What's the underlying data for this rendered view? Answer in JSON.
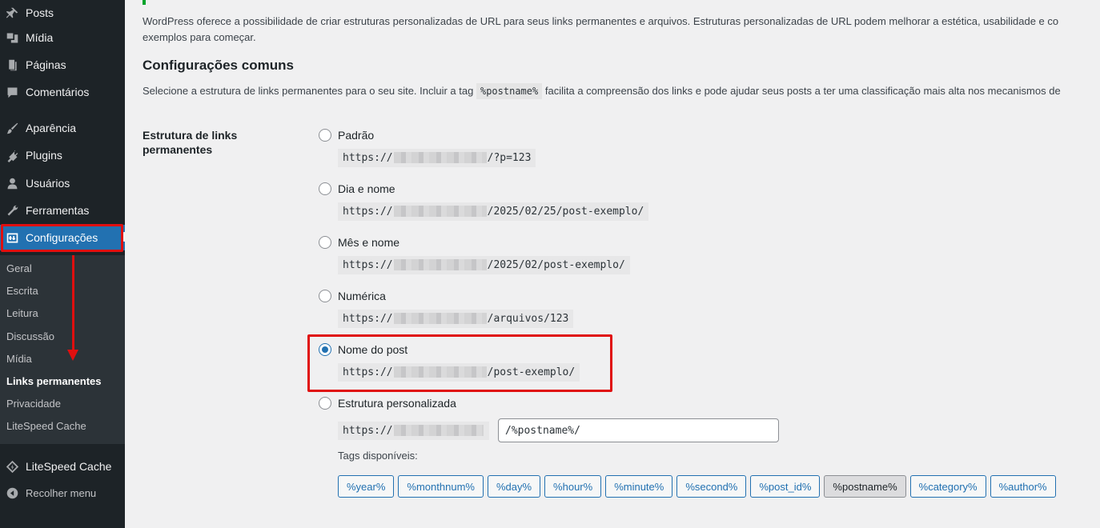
{
  "sidebar": {
    "items": [
      {
        "label": "Posts",
        "icon": "pin-icon"
      },
      {
        "label": "Mídia",
        "icon": "media-icon"
      },
      {
        "label": "Páginas",
        "icon": "pages-icon"
      },
      {
        "label": "Comentários",
        "icon": "comments-icon"
      },
      {
        "label": "Aparência",
        "icon": "brush-icon"
      },
      {
        "label": "Plugins",
        "icon": "plugin-icon"
      },
      {
        "label": "Usuários",
        "icon": "user-icon"
      },
      {
        "label": "Ferramentas",
        "icon": "wrench-icon"
      },
      {
        "label": "Configurações",
        "icon": "settings-icon"
      },
      {
        "label": "LiteSpeed Cache",
        "icon": "litespeed-icon"
      },
      {
        "label": "Recolher menu",
        "icon": "collapse-icon"
      }
    ],
    "submenu": [
      "Geral",
      "Escrita",
      "Leitura",
      "Discussão",
      "Mídia",
      "Links permanentes",
      "Privacidade",
      "LiteSpeed Cache"
    ],
    "current_submenu": "Links permanentes"
  },
  "main": {
    "intro_line1": "WordPress oferece a possibilidade de criar estruturas personalizadas de URL para seus links permanentes e arquivos. Estruturas personalizadas de URL podem melhorar a estética, usabilidade e co",
    "intro_line2": "exemplos para começar.",
    "section_title": "Configurações comuns",
    "section_desc_before": "Selecione a estrutura de links permanentes para o seu site. Incluir a tag",
    "section_desc_tag": "%postname%",
    "section_desc_after": "facilita a compreensão dos links e pode ajudar seus posts a ter uma classificação mais alta nos mecanismos de",
    "row_label": "Estrutura de links permanentes",
    "options": [
      {
        "label": "Padrão",
        "url_prefix": "https://",
        "url_suffix": "/?p=123",
        "checked": false
      },
      {
        "label": "Dia e nome",
        "url_prefix": "https://",
        "url_suffix": "/2025/02/25/post-exemplo/",
        "checked": false
      },
      {
        "label": "Mês e nome",
        "url_prefix": "https://",
        "url_suffix": "/2025/02/post-exemplo/",
        "checked": false
      },
      {
        "label": "Numérica",
        "url_prefix": "https://",
        "url_suffix": "/arquivos/123",
        "checked": false
      },
      {
        "label": "Nome do post",
        "url_prefix": "https://",
        "url_suffix": "/post-exemplo/",
        "checked": true
      },
      {
        "label": "Estrutura personalizada",
        "url_prefix": "https://",
        "url_suffix": "",
        "checked": false
      }
    ],
    "custom_structure_value": "/%postname%/",
    "tags_label": "Tags disponíveis:",
    "tags": [
      "%year%",
      "%monthnum%",
      "%day%",
      "%hour%",
      "%minute%",
      "%second%",
      "%post_id%",
      "%postname%",
      "%category%",
      "%author%"
    ],
    "active_tag": "%postname%"
  },
  "colors": {
    "sidebar_bg": "#1d2327",
    "submenu_bg": "#2c3338",
    "accent": "#2271b1",
    "annotation_red": "#e00f0f"
  }
}
